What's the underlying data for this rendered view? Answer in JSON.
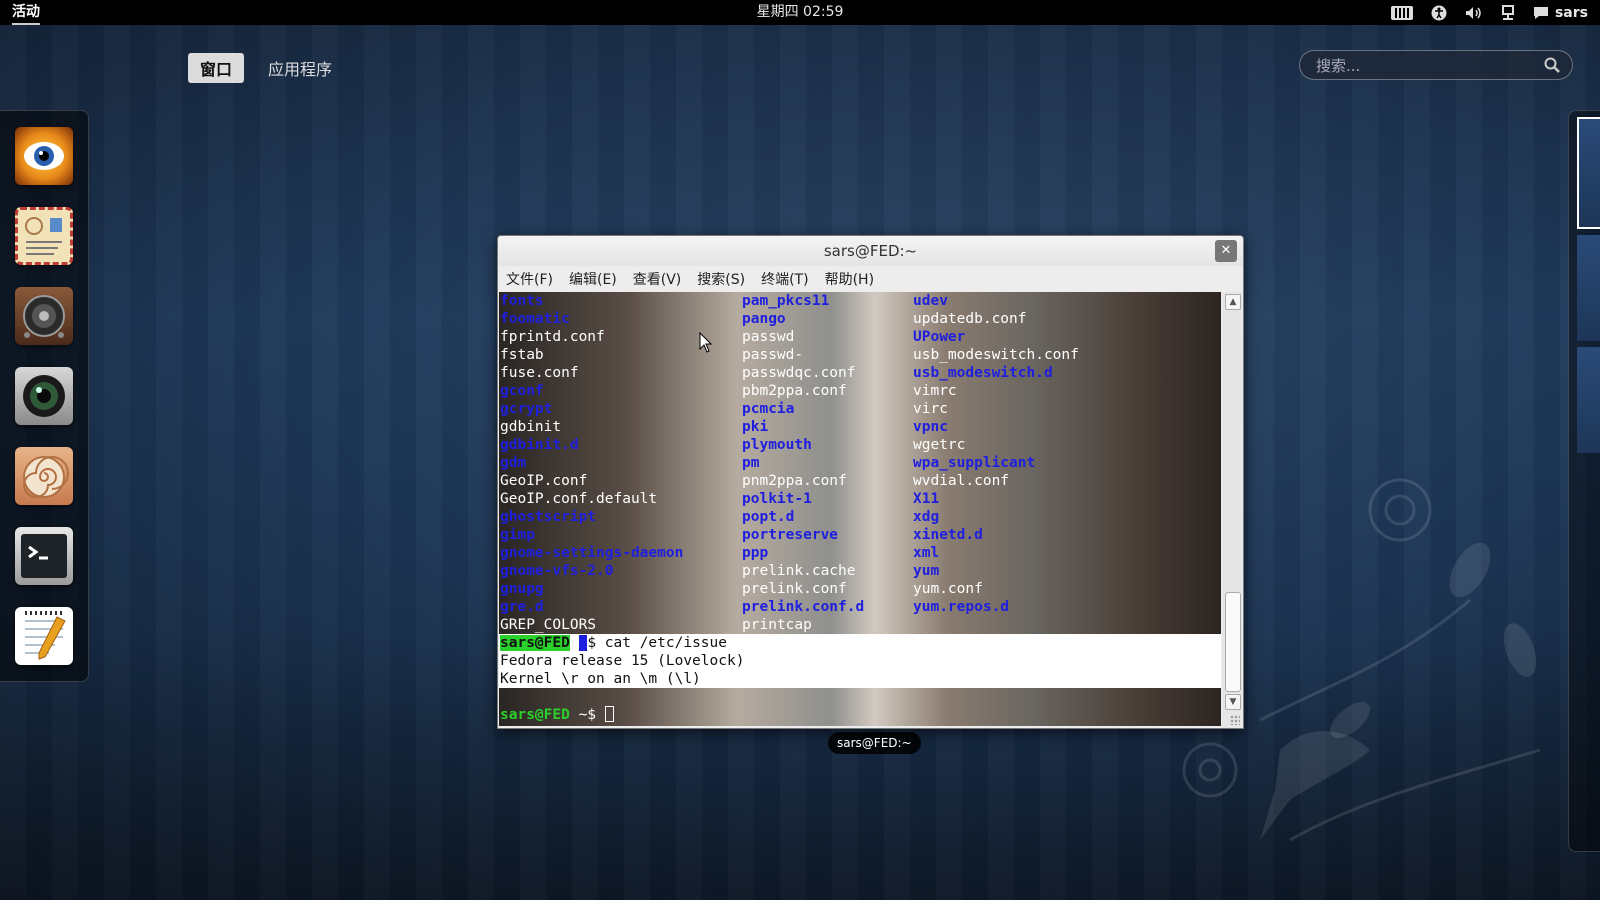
{
  "topbar": {
    "activities": "活动",
    "clock": "星期四 02:59",
    "user": "sars",
    "tray_icons": [
      "keyboard-icon",
      "accessibility-icon",
      "volume-icon",
      "network-icon",
      "chat-icon"
    ]
  },
  "overview": {
    "tabs": [
      {
        "label": "窗口",
        "active": true
      },
      {
        "label": "应用程序",
        "active": false
      }
    ],
    "search_placeholder": "搜索..."
  },
  "dash": {
    "items": [
      "eye-of-gnome-icon",
      "mail-icon",
      "speaker-icon",
      "camera-lens-icon",
      "nautilus-shell-icon",
      "terminal-icon",
      "text-editor-icon"
    ]
  },
  "window": {
    "title": "sars@FED:~",
    "close": "✕",
    "caption": "sars@FED:~",
    "menu": [
      "文件(F)",
      "编辑(E)",
      "查看(V)",
      "搜索(S)",
      "终端(T)",
      "帮助(H)"
    ]
  },
  "terminal": {
    "columns": [
      [
        {
          "t": "fonts",
          "c": "b"
        },
        {
          "t": "foomatic",
          "c": "b"
        },
        {
          "t": "fprintd.conf",
          "c": "w"
        },
        {
          "t": "fstab",
          "c": "w"
        },
        {
          "t": "fuse.conf",
          "c": "w"
        },
        {
          "t": "gconf",
          "c": "b"
        },
        {
          "t": "gcrypt",
          "c": "b"
        },
        {
          "t": "gdbinit",
          "c": "w"
        },
        {
          "t": "gdbinit.d",
          "c": "b"
        },
        {
          "t": "gdm",
          "c": "b"
        },
        {
          "t": "GeoIP.conf",
          "c": "w"
        },
        {
          "t": "GeoIP.conf.default",
          "c": "w"
        },
        {
          "t": "ghostscript",
          "c": "b"
        },
        {
          "t": "gimp",
          "c": "b"
        },
        {
          "t": "gnome-settings-daemon",
          "c": "b"
        },
        {
          "t": "gnome-vfs-2.0",
          "c": "b"
        },
        {
          "t": "gnupg",
          "c": "b"
        },
        {
          "t": "gre.d",
          "c": "b"
        },
        {
          "t": "GREP_COLORS",
          "c": "w"
        }
      ],
      [
        {
          "t": "pam_pkcs11",
          "c": "b"
        },
        {
          "t": "pango",
          "c": "b"
        },
        {
          "t": "passwd",
          "c": "w"
        },
        {
          "t": "passwd-",
          "c": "w"
        },
        {
          "t": "passwdqc.conf",
          "c": "w"
        },
        {
          "t": "pbm2ppa.conf",
          "c": "w"
        },
        {
          "t": "pcmcia",
          "c": "b"
        },
        {
          "t": "pki",
          "c": "b"
        },
        {
          "t": "plymouth",
          "c": "b"
        },
        {
          "t": "pm",
          "c": "b"
        },
        {
          "t": "pnm2ppa.conf",
          "c": "w"
        },
        {
          "t": "polkit-1",
          "c": "b"
        },
        {
          "t": "popt.d",
          "c": "b"
        },
        {
          "t": "portreserve",
          "c": "b"
        },
        {
          "t": "ppp",
          "c": "b"
        },
        {
          "t": "prelink.cache",
          "c": "w"
        },
        {
          "t": "prelink.conf",
          "c": "w"
        },
        {
          "t": "prelink.conf.d",
          "c": "b"
        },
        {
          "t": "printcap",
          "c": "w"
        }
      ],
      [
        {
          "t": "udev",
          "c": "b"
        },
        {
          "t": "updatedb.conf",
          "c": "w"
        },
        {
          "t": "UPower",
          "c": "b"
        },
        {
          "t": "usb_modeswitch.conf",
          "c": "w"
        },
        {
          "t": "usb_modeswitch.d",
          "c": "b"
        },
        {
          "t": "vimrc",
          "c": "w"
        },
        {
          "t": "virc",
          "c": "w"
        },
        {
          "t": "vpnc",
          "c": "b"
        },
        {
          "t": "wgetrc",
          "c": "w"
        },
        {
          "t": "wpa_supplicant",
          "c": "b"
        },
        {
          "t": "wvdial.conf",
          "c": "w"
        },
        {
          "t": "X11",
          "c": "b"
        },
        {
          "t": "xdg",
          "c": "b"
        },
        {
          "t": "xinetd.d",
          "c": "b"
        },
        {
          "t": "xml",
          "c": "b"
        },
        {
          "t": "yum",
          "c": "b"
        },
        {
          "t": "yum.conf",
          "c": "w"
        },
        {
          "t": "yum.repos.d",
          "c": "b"
        }
      ]
    ],
    "prompt_host": "sars@FED",
    "prompt_tail": "$ cat /etc/issue",
    "output": [
      "Fedora release 15 (Lovelock)",
      "Kernel \\r on an \\m (\\l)"
    ],
    "last_prompt_host": "sars@FED",
    "last_prompt_tail": " ~$ "
  }
}
